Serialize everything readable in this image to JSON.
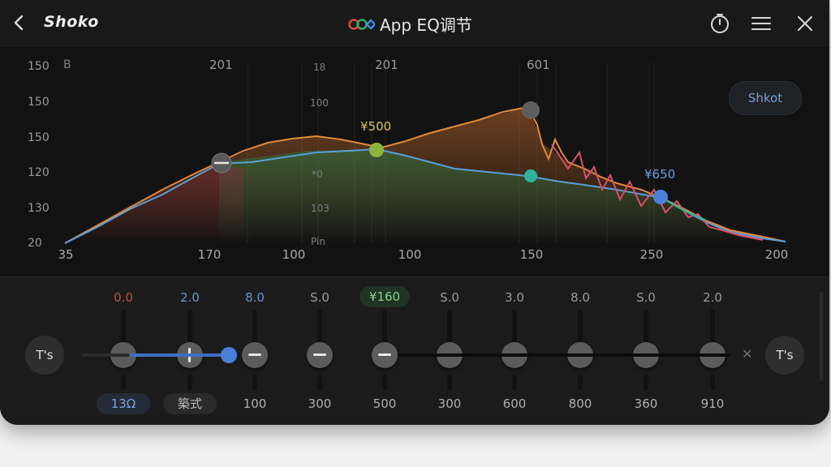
{
  "header": {
    "brand": "Shoko",
    "title": "App EQ调节",
    "icons": [
      "back-icon",
      "eq-logo-icon",
      "timer-icon",
      "menu-icon",
      "close-icon"
    ]
  },
  "graph": {
    "y_labels": [
      "150",
      "150",
      "150",
      "120",
      "130",
      "20"
    ],
    "x_labels": [
      "35",
      "170",
      "100",
      "100",
      "150",
      "250",
      "200"
    ],
    "top_labels": [
      "201",
      "201",
      "601"
    ],
    "ghost_labels": [
      "B",
      "18",
      "100",
      "*0",
      "103",
      "Pin"
    ],
    "annotations": [
      {
        "text": "¥500",
        "color": "#d8c84a"
      },
      {
        "text": "¥650",
        "color": "#6b9be8"
      }
    ],
    "action_button": "Shkot",
    "colors": {
      "orange": "#e08a3c",
      "blue": "#5aa0d8",
      "red": "#d9506a",
      "teal": "#2fb39a",
      "green_node": "#8cb43c"
    }
  },
  "eq": {
    "left_button": "T's",
    "right_button": "T's",
    "bands": [
      {
        "value": "0.0",
        "value_color": "#c84b4b",
        "freq": "13Ω",
        "freq_style": "pill-blue"
      },
      {
        "value": "2.0",
        "value_color": "#6f8fc8",
        "freq": "築式",
        "freq_style": "pill-gray"
      },
      {
        "value": "8.0",
        "value_color": "#6f8fc8",
        "freq": "100"
      },
      {
        "value": "S.0",
        "freq": "300"
      },
      {
        "value": "¥160",
        "freq": "500",
        "value_style": "pill"
      },
      {
        "value": "S.0",
        "freq": "300"
      },
      {
        "value": "3.0",
        "freq": "600"
      },
      {
        "value": "8.0",
        "freq": "800"
      },
      {
        "value": "S.0",
        "freq": "360"
      },
      {
        "value": "2.0",
        "freq": "910"
      }
    ]
  }
}
